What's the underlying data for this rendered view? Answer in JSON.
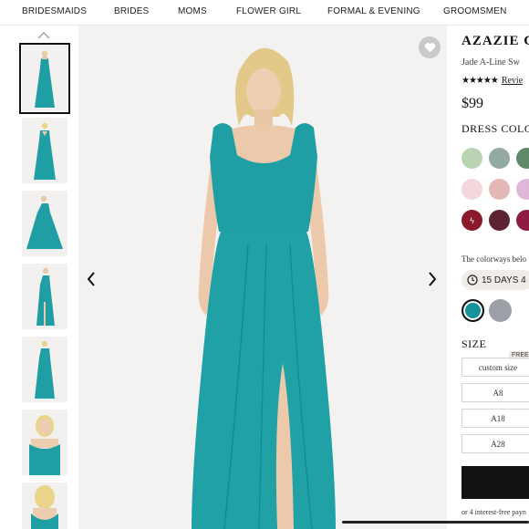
{
  "nav": {
    "items": [
      "BRIDESMAIDS",
      "BRIDES",
      "MOMS",
      "FLOWER GIRL",
      "FORMAL & EVENING",
      "GROOMSMEN"
    ]
  },
  "icons": {
    "thumbs_up": "chevron-up-icon",
    "prev": "chevron-left-icon",
    "next": "chevron-right-icon",
    "favorite": "heart-icon",
    "clock": "clock-icon",
    "bolt": "lightning-icon"
  },
  "product": {
    "brand": "AZAZIE C",
    "subtitle": "Jade A-Line Sw",
    "stars": "★★★★★",
    "rating": 4.5,
    "reviews_label": "Revie",
    "price": "$99",
    "color_label": "DRESS COLO",
    "colorways_note": "The colorways belo",
    "ship_label": "15 DAYS 4",
    "size_label": "SIZE",
    "free_tag": "FREE",
    "size_options": [
      "custom size",
      "A8",
      "A18",
      "A28"
    ],
    "payment_note": "or 4 interest-free payn"
  },
  "colors": {
    "dress": "#1f9fa3",
    "accent": "#111111",
    "swatches": [
      [
        "#b9d3b3",
        "#93aaa1",
        "#5f8a6a"
      ],
      [
        "#f2d7db",
        "#e4b8b6",
        "#e0b6d9"
      ],
      [
        "#8a1a2c",
        "#5b2430",
        "#8e1d44"
      ]
    ],
    "selected_swatches": [
      "#15939a",
      "#9aa0a6"
    ]
  }
}
